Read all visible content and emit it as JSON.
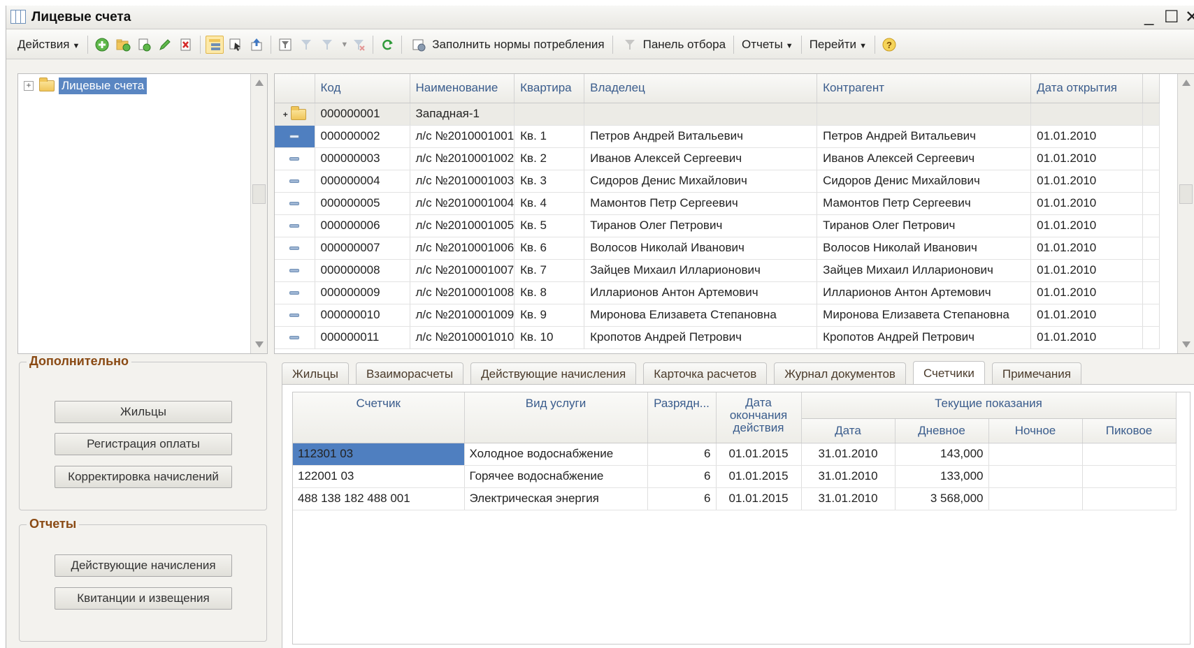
{
  "window": {
    "title": "Лицевые счета",
    "minimize": "_",
    "maximize": "☐",
    "close": "✕"
  },
  "toolbar": {
    "actions": "Действия",
    "fill_norms": "Заполнить нормы потребления",
    "filter_panel": "Панель отбора",
    "reports": "Отчеты",
    "go": "Перейти"
  },
  "tree": {
    "root_label": "Лицевые счета"
  },
  "additional": {
    "title": "Дополнительно",
    "buttons": [
      "Жильцы",
      "Регистрация оплаты",
      "Корректировка начислений"
    ]
  },
  "reports_box": {
    "title": "Отчеты",
    "buttons": [
      "Действующие начисления",
      "Квитанции и извещения"
    ]
  },
  "grid": {
    "columns": [
      "Код",
      "Наименование",
      "Квартира",
      "Владелец",
      "Контрагент",
      "Дата открытия"
    ],
    "group_row": {
      "code": "000000001",
      "name": "Западная-1"
    },
    "rows": [
      {
        "code": "000000002",
        "name": "л/с №2010001001",
        "apt": "Кв. 1",
        "owner": "Петров Андрей Витальевич",
        "contractor": "Петров Андрей Витальевич",
        "date": "01.01.2010"
      },
      {
        "code": "000000003",
        "name": "л/с №2010001002",
        "apt": "Кв. 2",
        "owner": "Иванов Алексей Сергеевич",
        "contractor": "Иванов Алексей Сергеевич",
        "date": "01.01.2010"
      },
      {
        "code": "000000004",
        "name": "л/с №2010001003",
        "apt": "Кв. 3",
        "owner": "Сидоров Денис Михайлович",
        "contractor": "Сидоров Денис Михайлович",
        "date": "01.01.2010"
      },
      {
        "code": "000000005",
        "name": "л/с №2010001004",
        "apt": "Кв. 4",
        "owner": "Мамонтов Петр Сергеевич",
        "contractor": "Мамонтов Петр Сергеевич",
        "date": "01.01.2010"
      },
      {
        "code": "000000006",
        "name": "л/с №2010001005",
        "apt": "Кв. 5",
        "owner": "Тиранов Олег Петрович",
        "contractor": "Тиранов Олег Петрович",
        "date": "01.01.2010"
      },
      {
        "code": "000000007",
        "name": "л/с №2010001006",
        "apt": "Кв. 6",
        "owner": "Волосов Николай Иванович",
        "contractor": "Волосов Николай Иванович",
        "date": "01.01.2010"
      },
      {
        "code": "000000008",
        "name": "л/с №2010001007",
        "apt": "Кв. 7",
        "owner": "Зайцев Михаил Илларионович",
        "contractor": "Зайцев Михаил Илларионович",
        "date": "01.01.2010"
      },
      {
        "code": "000000009",
        "name": "л/с №2010001008",
        "apt": "Кв. 8",
        "owner": "Илларионов Антон Артемович",
        "contractor": "Илларионов Антон Артемович",
        "date": "01.01.2010"
      },
      {
        "code": "000000010",
        "name": "л/с №2010001009",
        "apt": "Кв. 9",
        "owner": "Миронова Елизавета Степановна",
        "contractor": "Миронова Елизавета Степановна",
        "date": "01.01.2010"
      },
      {
        "code": "000000011",
        "name": "л/с №2010001010",
        "apt": "Кв. 10",
        "owner": "Кропотов Андрей Петрович",
        "contractor": "Кропотов Андрей Петрович",
        "date": "01.01.2010"
      }
    ]
  },
  "tabs": [
    "Жильцы",
    "Взаиморасчеты",
    "Действующие начисления",
    "Карточка расчетов",
    "Журнал документов",
    "Счетчики",
    "Примечания"
  ],
  "active_tab": "Счетчики",
  "meters": {
    "headers": {
      "meter": "Счетчик",
      "service": "Вид услуги",
      "digits": "Разрядн...",
      "end_date": "Дата окончания действия",
      "current": "Текущие показания",
      "date": "Дата",
      "day": "Дневное",
      "night": "Ночное",
      "peak": "Пиковое"
    },
    "rows": [
      {
        "meter": "112301 03",
        "service": "Холодное водоснабжение",
        "digits": "6",
        "end_date": "01.01.2015",
        "date": "31.01.2010",
        "day": "143,000",
        "night": "",
        "peak": ""
      },
      {
        "meter": "122001 03",
        "service": "Горячее водоснабжение",
        "digits": "6",
        "end_date": "01.01.2015",
        "date": "31.01.2010",
        "day": "133,000",
        "night": "",
        "peak": ""
      },
      {
        "meter": "488 138 182 488 001",
        "service": "Электрическая энергия",
        "digits": "6",
        "end_date": "01.01.2015",
        "date": "31.01.2010",
        "day": "3 568,000",
        "night": "",
        "peak": ""
      }
    ]
  },
  "colors": {
    "selection": "#4f7fc0",
    "group_title": "#8a4a14",
    "header_text": "#3a5c8c"
  }
}
